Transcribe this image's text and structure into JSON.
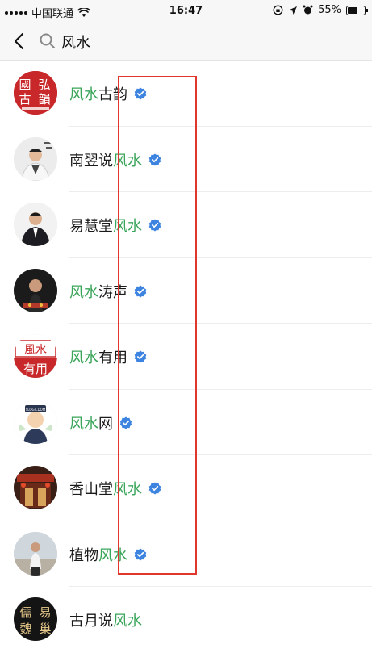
{
  "status": {
    "carrier": "中国联通",
    "time": "16:47",
    "battery": "55%"
  },
  "search": {
    "query": "风水"
  },
  "results": [
    {
      "pre": "",
      "hl": "风水",
      "post": "古韵",
      "verified": true
    },
    {
      "pre": "南翌说",
      "hl": "风水",
      "post": "",
      "verified": true
    },
    {
      "pre": "易慧堂",
      "hl": "风水",
      "post": "",
      "verified": true
    },
    {
      "pre": "",
      "hl": "风水",
      "post": "涛声",
      "verified": true
    },
    {
      "pre": "",
      "hl": "风水",
      "post": "有用",
      "verified": true
    },
    {
      "pre": "",
      "hl": "风水",
      "post": "网",
      "verified": true
    },
    {
      "pre": "香山堂",
      "hl": "风水",
      "post": "",
      "verified": true
    },
    {
      "pre": "植物",
      "hl": "风水",
      "post": "",
      "verified": true
    },
    {
      "pre": "古月说",
      "hl": "风水",
      "post": "",
      "verified": false
    }
  ],
  "avatar_text": {
    "row0": [
      "國",
      "弘",
      "古",
      "韻"
    ],
    "row4": "風水",
    "row4b": "有用",
    "row5": "SLOGICDOM",
    "row8": [
      "儒",
      "易",
      "魏",
      "巢"
    ]
  },
  "colors": {
    "highlight": "#3aa55a",
    "verified": "#3d84e0",
    "annotation_box": "#e0362c"
  }
}
